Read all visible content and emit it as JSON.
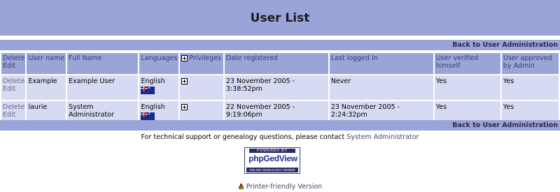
{
  "page": {
    "title": "User List"
  },
  "nav": {
    "back_label": "Back to User Administration"
  },
  "table": {
    "headers": {
      "actions_line1": "Delete",
      "actions_line2": "Edit",
      "user_name": "User name",
      "full_name": "Full Name",
      "languages": "Languages",
      "privileges": "Privileges",
      "date_registered": "Date registered",
      "last_logged_in": "Last logged in",
      "verified": "User verified himself",
      "approved": "User approved by Admin"
    },
    "rows": [
      {
        "delete": "Delete",
        "edit": "Edit",
        "user_name": "Example",
        "full_name": "Example User",
        "language": "English",
        "flag": "australia-flag-icon",
        "date_registered": "23 November 2005 - 3:38:52pm",
        "last_logged_in": "Never",
        "verified": "Yes",
        "approved": "Yes"
      },
      {
        "delete": "Delete",
        "edit": "Edit",
        "user_name": "laurie",
        "full_name": "System Administrator",
        "language": "English",
        "flag": "australia-flag-icon",
        "date_registered": "22 November 2005 - 9:19:06pm",
        "last_logged_in": "23 November 2005 - 2:24:32pm",
        "verified": "Yes",
        "approved": "Yes"
      }
    ]
  },
  "footer": {
    "support_text": "For technical support or genealogy questions, please contact",
    "support_link": "System Administrator",
    "logo": {
      "powered": "POWERED BY",
      "name": "phpGedView",
      "tagline": "ONLINE GENEALOGY VIEWER"
    },
    "printer_link": "Printer-friendly Version"
  },
  "colors": {
    "header_bg": "#9ba4d8",
    "row_bg": "#d6dbf3"
  }
}
